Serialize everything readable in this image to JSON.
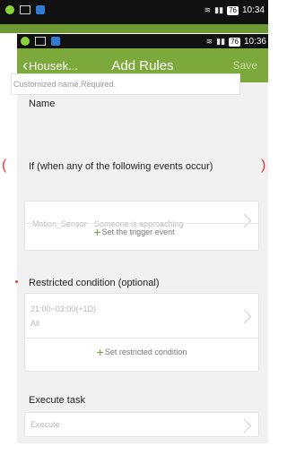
{
  "outer_status_bar": {
    "time": "10:34",
    "battery": "76"
  },
  "inner_status_bar": {
    "time": "10:36",
    "battery": "76"
  },
  "navbar": {
    "back_label": "Housek...",
    "title": "Add Rules",
    "save_label": "Save",
    "accent_color": "#7ca83c"
  },
  "name_section": {
    "label": "Name",
    "placeholder": "Customized name,Required."
  },
  "if_section": {
    "label": "If (when any of the following events occur)",
    "event_device": "Motion_Sensor",
    "event_desc": "Someone is approaching",
    "add_label": "Set the trigger event"
  },
  "restricted_section": {
    "label": "Restricted condition (optional)",
    "time_range": "21:00~03:00(+1D)",
    "days": "All",
    "add_label": "Set restricted condition"
  },
  "execute_section": {
    "label": "Execute task",
    "placeholder": "Execute"
  }
}
